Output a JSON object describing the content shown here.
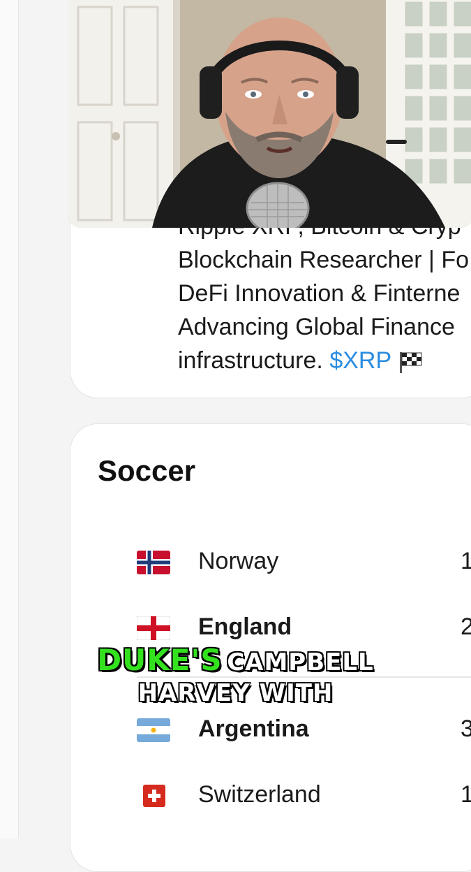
{
  "bio": {
    "lines": [
      "Ripple XRP, Bitcoin & Cryp",
      "Blockchain Researcher | Fo",
      "DeFi Innovation & Finterne",
      "Advancing Global Finance",
      "infrastructure."
    ],
    "ticker": "$XRP"
  },
  "soccer": {
    "title": "Soccer",
    "teams": [
      {
        "name": "Norway",
        "rank": "1"
      },
      {
        "name": "England",
        "rank": "2"
      },
      {
        "name": "Argentina",
        "rank": "3"
      },
      {
        "name": "Switzerland",
        "rank": "1"
      }
    ]
  },
  "caption": {
    "highlight": "DUKE'S",
    "line1_rest": "CAMPBELL",
    "line2": "HARVEY WITH"
  },
  "colors": {
    "ticker": "#2a8de0",
    "caption_highlight": "#33e11f"
  },
  "icons": [
    "checkered-flag-icon",
    "norway-flag-icon",
    "england-flag-icon",
    "argentina-flag-icon",
    "switzerland-flag-icon"
  ]
}
